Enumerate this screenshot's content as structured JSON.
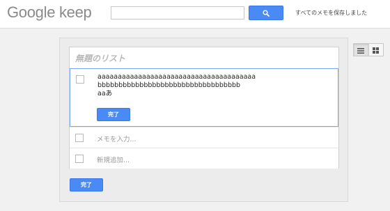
{
  "header": {
    "logo": "Google keep",
    "search": {
      "value": "",
      "placeholder": ""
    },
    "search_icon": "search-icon",
    "saved_status": "すべてのメモを保存しました"
  },
  "note": {
    "title_placeholder": "無題のリスト",
    "active_item": {
      "lines": [
        "aaaaaaaaaaaaaaaaaaaaaaaaaaaaaaaaaaaaaaa",
        "bbbbbbbbbbbbbbbbbbbbbbbbbbbbbbbbbb",
        "aaあ"
      ],
      "done_label": "完了"
    },
    "memo_placeholder": "メモを入力...",
    "add_item_placeholder": "新規追加..."
  },
  "footer": {
    "done_label": "完了"
  },
  "view_toggle": {
    "list_icon": "list-view-icon",
    "grid_icon": "grid-view-icon",
    "active": "list"
  },
  "colors": {
    "accent": "#4a8af4",
    "active_border": "#7aa7f2",
    "background": "#f1f1f1"
  }
}
